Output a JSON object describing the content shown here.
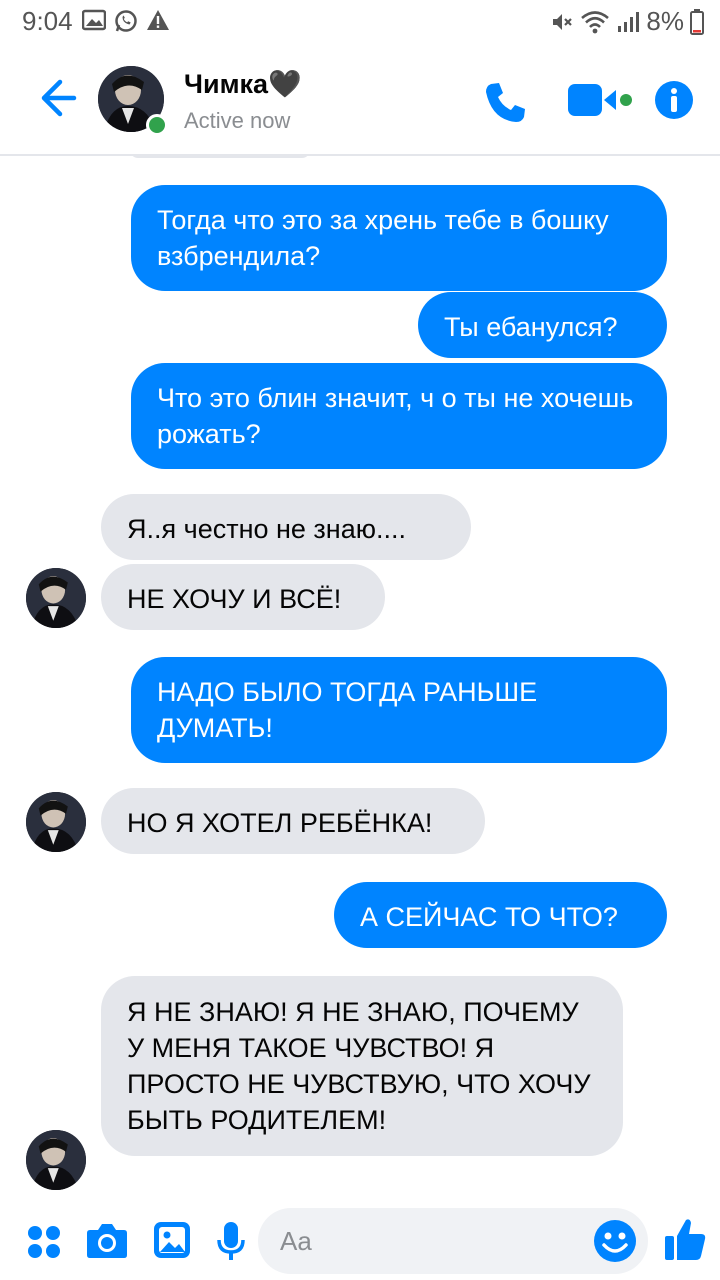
{
  "status_bar": {
    "time": "9:04",
    "battery": "8%"
  },
  "header": {
    "contact_name": "Чимка🖤",
    "status": "Active now"
  },
  "messages": [
    {
      "side": "out",
      "text": "Тогда что это за хрень тебе в бошку взбрендила?"
    },
    {
      "side": "out",
      "text": "Ты ебанулся?"
    },
    {
      "side": "out",
      "text": "Что это блин значит, ч о ты не хочешь рожать?"
    },
    {
      "side": "in",
      "text": "Я..я честно не знаю...."
    },
    {
      "side": "in",
      "text": "НЕ ХОЧУ И ВСЁ!"
    },
    {
      "side": "out",
      "text": "НАДО БЫЛО ТОГДА РАНЬШЕ ДУМАТЬ!"
    },
    {
      "side": "in",
      "text": "НО Я ХОТЕЛ РЕБЁНКА!"
    },
    {
      "side": "out",
      "text": "А СЕЙЧАС ТО ЧТО?"
    },
    {
      "side": "in",
      "text": "Я НЕ ЗНАЮ! Я НЕ ЗНАЮ, ПОЧЕМУ У МЕНЯ ТАКОЕ ЧУВСТВО! Я ПРОСТО НЕ ЧУВСТВУЮ, ЧТО ХОЧУ БЫТЬ РОДИТЕЛЕМ!"
    }
  ],
  "composer": {
    "placeholder": "Aa"
  },
  "colors": {
    "accent": "#0084ff",
    "incoming_bubble": "#e4e6eb",
    "online": "#31a24c"
  }
}
